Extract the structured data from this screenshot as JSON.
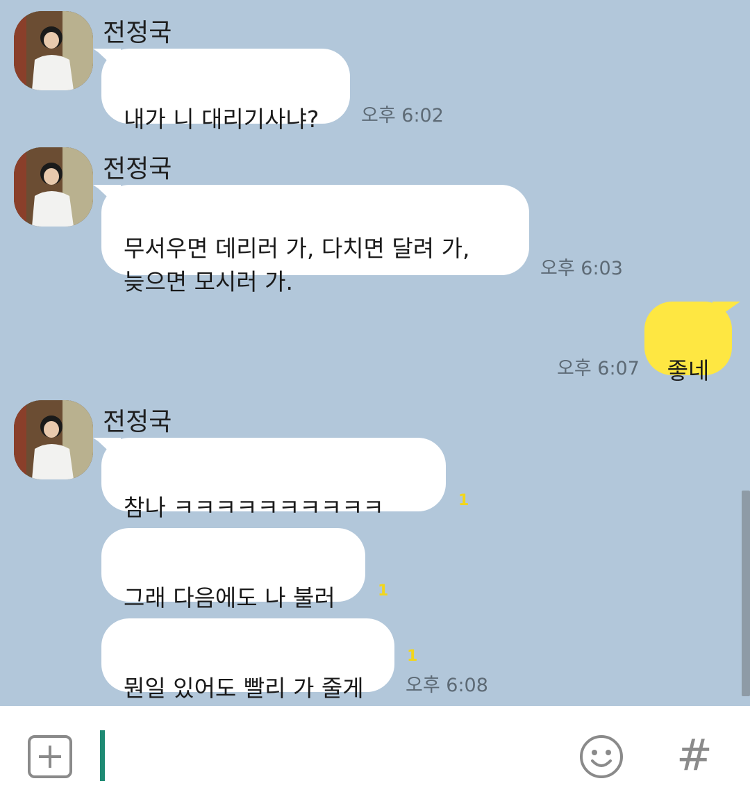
{
  "messages": [
    {
      "sender": "전정국",
      "text": "내가 니 대리기사냐?",
      "time": "오후 6:02"
    },
    {
      "sender": "전정국",
      "text": "무서우면 데리러 가, 다치면 달려 가,\n늦으면 모시러 가.",
      "time": "오후 6:03"
    },
    {
      "sender": "me",
      "text": "좋네",
      "time": "오후 6:07"
    },
    {
      "sender": "전정국",
      "text": "참나 ㅋㅋㅋㅋㅋㅋㅋㅋㅋㅋ",
      "unread": "1"
    },
    {
      "sender": "전정국",
      "text": "그래 다음에도 나 불러",
      "unread": "1"
    },
    {
      "sender": "전정국",
      "text": "뭔일 있어도 빨리 가 줄게",
      "unread": "1",
      "time": "오후 6:08"
    }
  ],
  "colors": {
    "background": "#b2c7da",
    "bubble_in": "#ffffff",
    "bubble_out": "#fee742",
    "caret": "#1e8a73"
  },
  "input": {
    "plus_icon": "plus-icon",
    "emoji_icon": "emoji-icon",
    "hash_label": "#"
  }
}
